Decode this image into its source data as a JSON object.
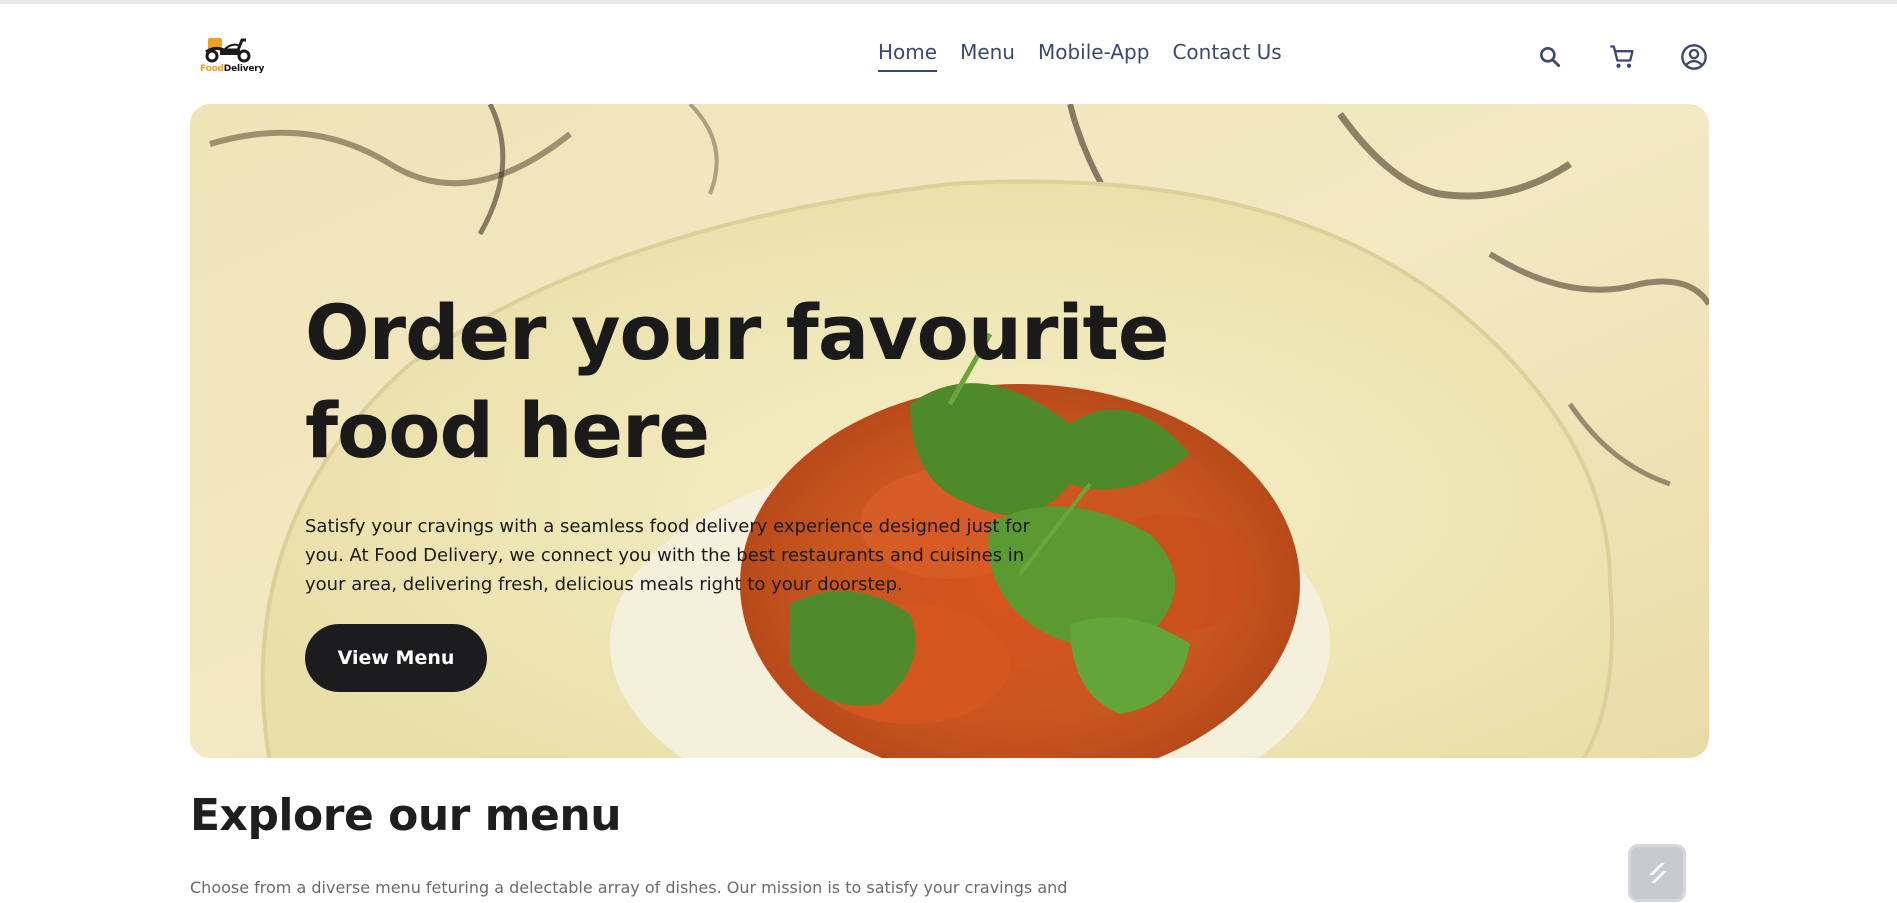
{
  "navbar": {
    "logo": {
      "text_main": "Delivery",
      "text_accent": "Food",
      "icon": "scooter-logo-icon"
    },
    "links": [
      {
        "label": "Home",
        "active": true
      },
      {
        "label": "Menu",
        "active": false
      },
      {
        "label": "Mobile-App",
        "active": false
      },
      {
        "label": "Contact Us",
        "active": false
      }
    ],
    "icons": [
      "search-icon",
      "cart-icon",
      "user-profile-icon"
    ]
  },
  "hero": {
    "title": "Order your favourite food here",
    "description": "Satisfy your cravings with a seamless food delivery experience designed just for you. At Food Delivery, we connect you with the best restaurants and cuisines in your area, delivering fresh, delicious meals right to your doorstep.",
    "button_label": "View Menu"
  },
  "explore": {
    "title": "Explore our menu",
    "description": "Choose from a diverse menu feturing a delectable array of dishes. Our mission is to satisfy your cravings and"
  },
  "floating_widget": {
    "icon": "bolt-widget-icon"
  },
  "colors": {
    "nav_text": "#3b4a6b",
    "button_bg": "#1c1c1f",
    "accent": "#f0a020"
  }
}
